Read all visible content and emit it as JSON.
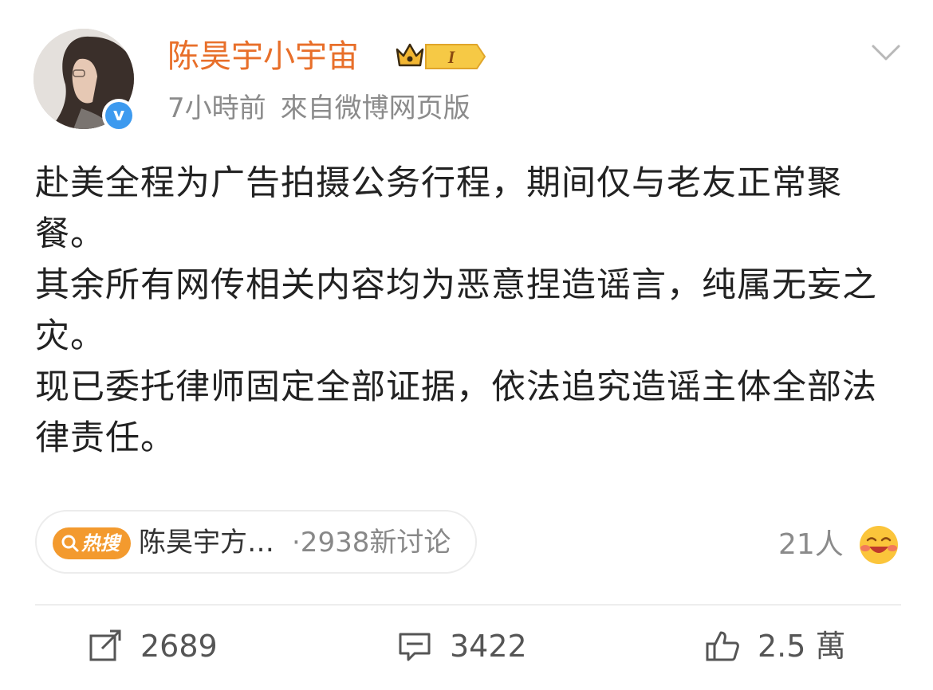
{
  "user": {
    "name": "陈昊宇小宇宙",
    "vip_level": "I",
    "time": "7小時前",
    "source": "來自微博网页版"
  },
  "post": {
    "lines": [
      "赴美全程为广告拍摄公务行程，期间仅与老友正常聚餐。",
      "其余所有网传相关内容均为恶意捏造谣言，纯属无妄之灾。",
      "现已委托律师固定全部证据，依法追究造谣主体全部法律责任。"
    ]
  },
  "hot_search": {
    "tag": "热搜",
    "title": "陈昊宇方…",
    "count": "·2938新讨论"
  },
  "reactions": {
    "count": "21人",
    "emoji": "laugh-cry-emoji"
  },
  "actions": {
    "repost": "2689",
    "comment": "3422",
    "like": "2.5 萬"
  },
  "colors": {
    "username": "#e86f2a",
    "hot_tag": "#f39a2e",
    "verify": "#3d9aef",
    "meta": "#8b8b8b"
  }
}
